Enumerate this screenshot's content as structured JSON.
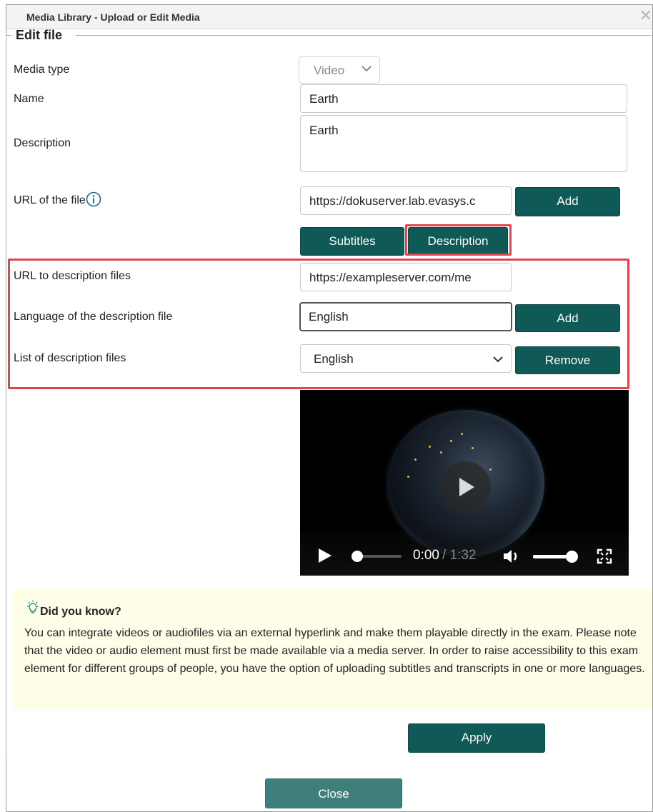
{
  "window": {
    "title": "Media Library - Upload or Edit Media"
  },
  "form": {
    "legend": "Edit file",
    "media_type": {
      "label": "Media type",
      "value": "Video"
    },
    "name": {
      "label": "Name",
      "value": "Earth"
    },
    "description": {
      "label": "Description",
      "value": "Earth"
    },
    "url_file": {
      "label": "URL of the file",
      "value": "https://dokuserver.lab.evasys.c",
      "add_label": "Add"
    },
    "tabs": {
      "subtitles": "Subtitles",
      "description": "Description"
    },
    "url_desc": {
      "label": "URL to description files",
      "value": "https://exampleserver.com/me"
    },
    "lang_desc": {
      "label": "Language of the description file",
      "value": "English",
      "add_label": "Add"
    },
    "list_desc": {
      "label": "List of description files",
      "selected": "English",
      "remove_label": "Remove"
    }
  },
  "video": {
    "current_time": "0:00",
    "duration": "/ 1:32",
    "progress": 0.0,
    "volume": 1.0
  },
  "tip": {
    "heading": "Did you know?",
    "text": "You can integrate videos or audiofiles via an external hyperlink and make them playable directly in the exam. Please note that the video or audio element must first be made available via a media server. In order to raise accessibility to this exam element for different groups of people, you have the option of uploading subtitles and transcripts in one or more languages."
  },
  "actions": {
    "apply": "Apply",
    "close": "Close"
  },
  "colors": {
    "primary": "#0f5a57",
    "highlight": "#e0474c",
    "tip_bg": "#fdfde8"
  }
}
